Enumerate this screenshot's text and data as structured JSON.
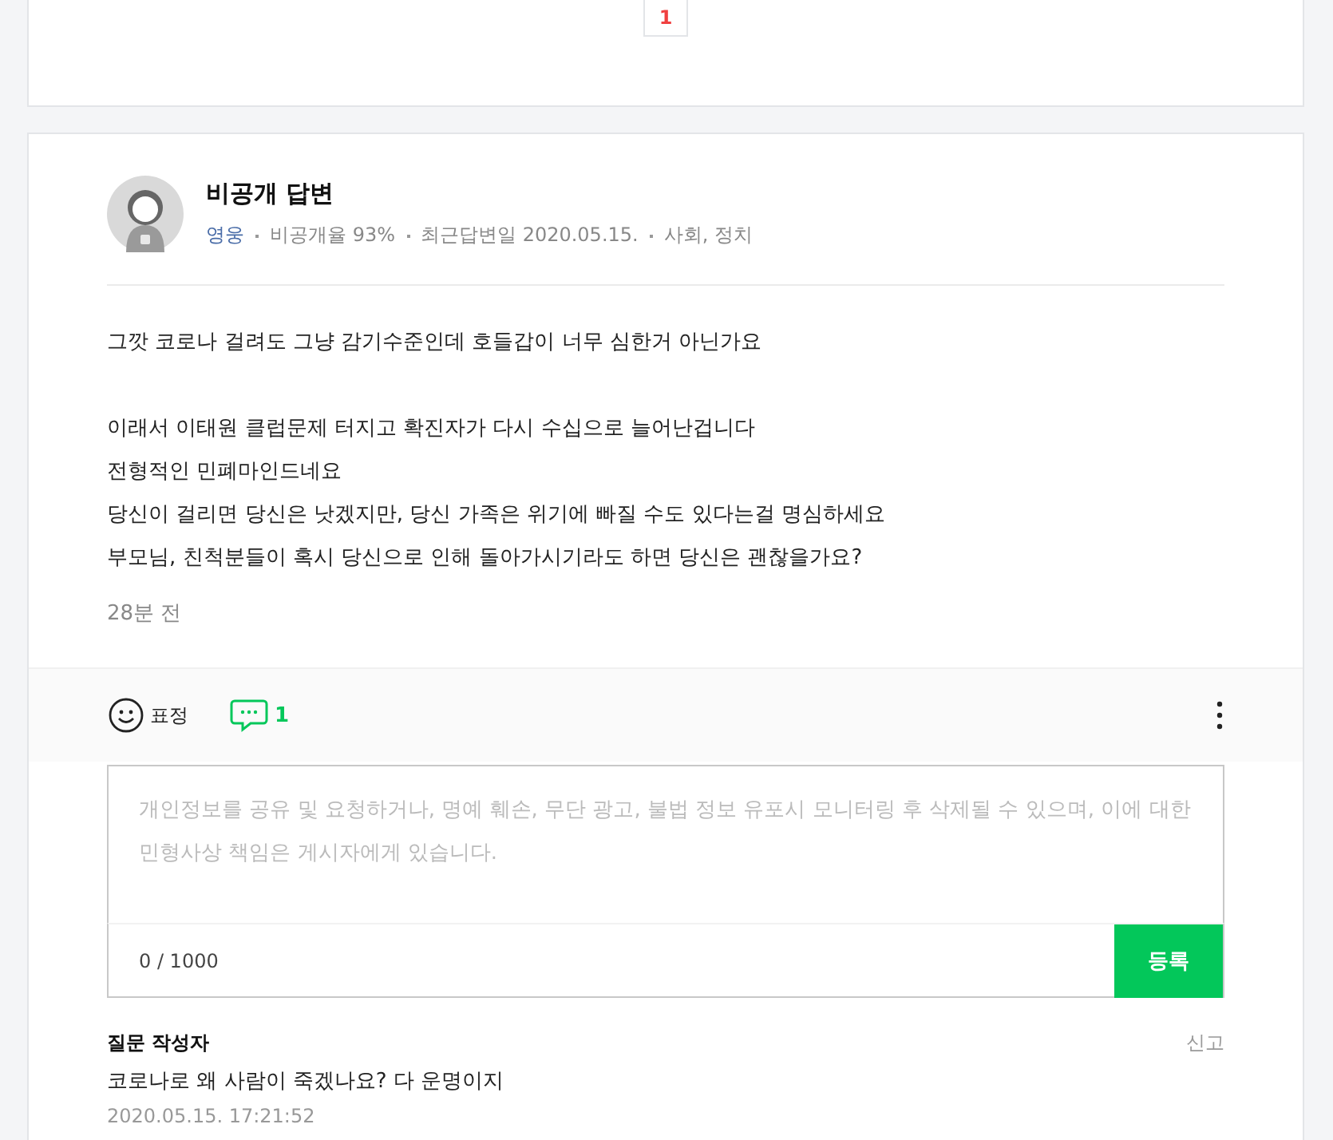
{
  "pagination": {
    "pages": [
      {
        "label": "1",
        "selected": true
      }
    ]
  },
  "answer": {
    "author": "비공개 답변",
    "grade": "영웅",
    "meta": [
      "비공개율 93%",
      "최근답변일 2020.05.15.",
      "사회, 정치"
    ],
    "paragraphs": [
      [
        "그깟 코로나 걸려도 그냥 감기수준인데 호들갑이 너무 심한거 아닌가요"
      ],
      [
        "이래서 이태원 클럽문제 터지고 확진자가 다시 수십으로 늘어난겁니다",
        "전형적인 민폐마인드네요",
        "당신이 걸리면 당신은 낫겠지만, 당신 가족은 위기에 빠질 수도 있다는걸 명심하세요",
        "부모님, 친척분들이 혹시 당신으로 인해 돌아가시기라도 하면 당신은 괜찮을가요?"
      ]
    ],
    "time": "28분 전",
    "actions": {
      "emotion_label": "표정",
      "comment_count": "1"
    },
    "comment_form": {
      "placeholder": "개인정보를 공유 및 요청하거나, 명예 훼손, 무단 광고, 불법 정보 유포시 모니터링 후 삭제될 수 있으며, 이에 대한 민형사상 책임은 게시자에게 있습니다.",
      "counter": "0 / 1000",
      "submit": "등록"
    },
    "comments": [
      {
        "author": "질문 작성자",
        "report": "신고",
        "text": "코로나로 왜 사람이 죽겠나요? 다 운명이지",
        "date": "2020.05.15. 17:21:52"
      }
    ]
  }
}
